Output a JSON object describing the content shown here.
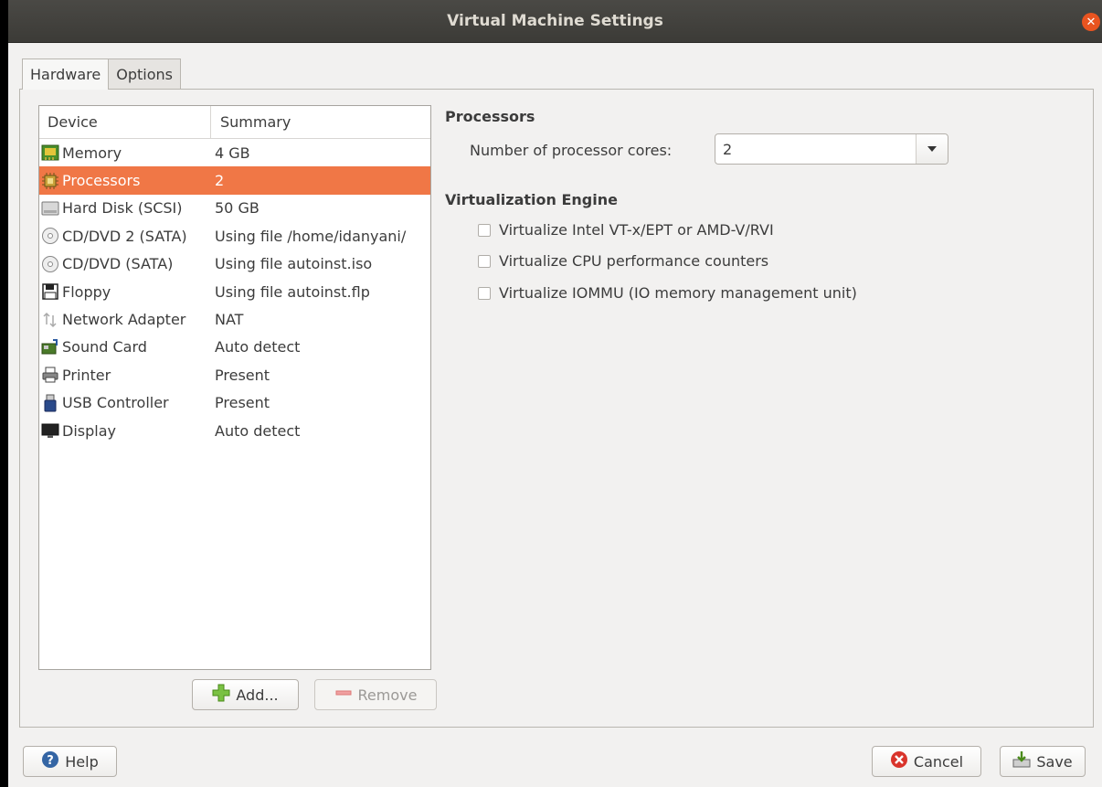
{
  "window": {
    "title": "Virtual Machine Settings"
  },
  "tabs": [
    {
      "label": "Hardware",
      "active": true
    },
    {
      "label": "Options",
      "active": false
    }
  ],
  "device_list": {
    "columns": {
      "device": "Device",
      "summary": "Summary"
    },
    "selected_index": 1,
    "rows": [
      {
        "device": "Memory",
        "summary": "4 GB",
        "icon": "memory-icon"
      },
      {
        "device": "Processors",
        "summary": "2",
        "icon": "processor-icon"
      },
      {
        "device": "Hard Disk (SCSI)",
        "summary": "50 GB",
        "icon": "hard-disk-icon"
      },
      {
        "device": "CD/DVD 2 (SATA)",
        "summary": "Using file /home/idanyani/",
        "icon": "cd-dvd-icon"
      },
      {
        "device": "CD/DVD (SATA)",
        "summary": "Using file autoinst.iso",
        "icon": "cd-dvd-icon"
      },
      {
        "device": "Floppy",
        "summary": "Using file autoinst.flp",
        "icon": "floppy-icon"
      },
      {
        "device": "Network Adapter",
        "summary": "NAT",
        "icon": "network-icon"
      },
      {
        "device": "Sound Card",
        "summary": "Auto detect",
        "icon": "sound-card-icon"
      },
      {
        "device": "Printer",
        "summary": "Present",
        "icon": "printer-icon"
      },
      {
        "device": "USB Controller",
        "summary": "Present",
        "icon": "usb-icon"
      },
      {
        "device": "Display",
        "summary": "Auto detect",
        "icon": "display-icon"
      }
    ],
    "add_label": "Add...",
    "remove_label": "Remove"
  },
  "processors": {
    "heading": "Processors",
    "cores_label": "Number of processor cores:",
    "cores_value": "2"
  },
  "virtualization": {
    "heading": "Virtualization Engine",
    "options": [
      {
        "label": "Virtualize Intel VT-x/EPT or AMD-V/RVI",
        "checked": false
      },
      {
        "label": "Virtualize CPU performance counters",
        "checked": false
      },
      {
        "label": "Virtualize IOMMU (IO memory management unit)",
        "checked": false
      }
    ]
  },
  "footer": {
    "help_label": "Help",
    "cancel_label": "Cancel",
    "save_label": "Save"
  },
  "colors": {
    "selection": "#f07746",
    "titlebar": "#3c3b37",
    "accent_close": "#e95420"
  }
}
